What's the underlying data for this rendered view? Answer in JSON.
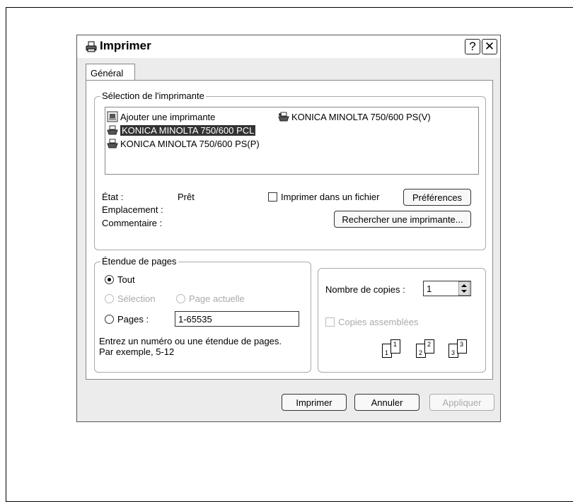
{
  "window": {
    "title": "Imprimer",
    "help_label": "?",
    "close_label": "✕"
  },
  "tabs": [
    {
      "label": "Général"
    }
  ],
  "printer_selection": {
    "legend": "Sélection de l'imprimante",
    "printers": [
      {
        "label": "Ajouter une imprimante",
        "icon": "add-printer-icon",
        "selected": false
      },
      {
        "label": "KONICA MINOLTA 750/600 PS(V)",
        "icon": "printer-icon",
        "selected": false
      },
      {
        "label": "KONICA MINOLTA 750/600 PCL",
        "icon": "printer-icon",
        "selected": true
      },
      {
        "label": "KONICA MINOLTA 750/600 PS(P)",
        "icon": "printer-icon",
        "selected": false
      }
    ],
    "status_label": "État :",
    "status_value": "Prêt",
    "location_label": "Emplacement :",
    "comment_label": "Commentaire :",
    "print_to_file_label": "Imprimer dans un fichier",
    "print_to_file_checked": false,
    "preferences_button": "Préférences",
    "find_printer_button": "Rechercher une imprimante..."
  },
  "page_range": {
    "legend": "Étendue de pages",
    "all_label": "Tout",
    "selection_label": "Sélection",
    "current_page_label": "Page actuelle",
    "pages_label": "Pages :",
    "pages_value": "1-65535",
    "selected_option": "all",
    "hint_line1": "Entrez un numéro ou une étendue de pages.",
    "hint_line2": "Par exemple, 5-12"
  },
  "copies": {
    "label": "Nombre de copies :",
    "value": "1",
    "collate_label": "Copies assemblées",
    "collate_checked": false,
    "collate_pages": [
      "1",
      "1",
      "2",
      "2",
      "3",
      "3"
    ]
  },
  "buttons": {
    "print": "Imprimer",
    "cancel": "Annuler",
    "apply": "Appliquer"
  }
}
